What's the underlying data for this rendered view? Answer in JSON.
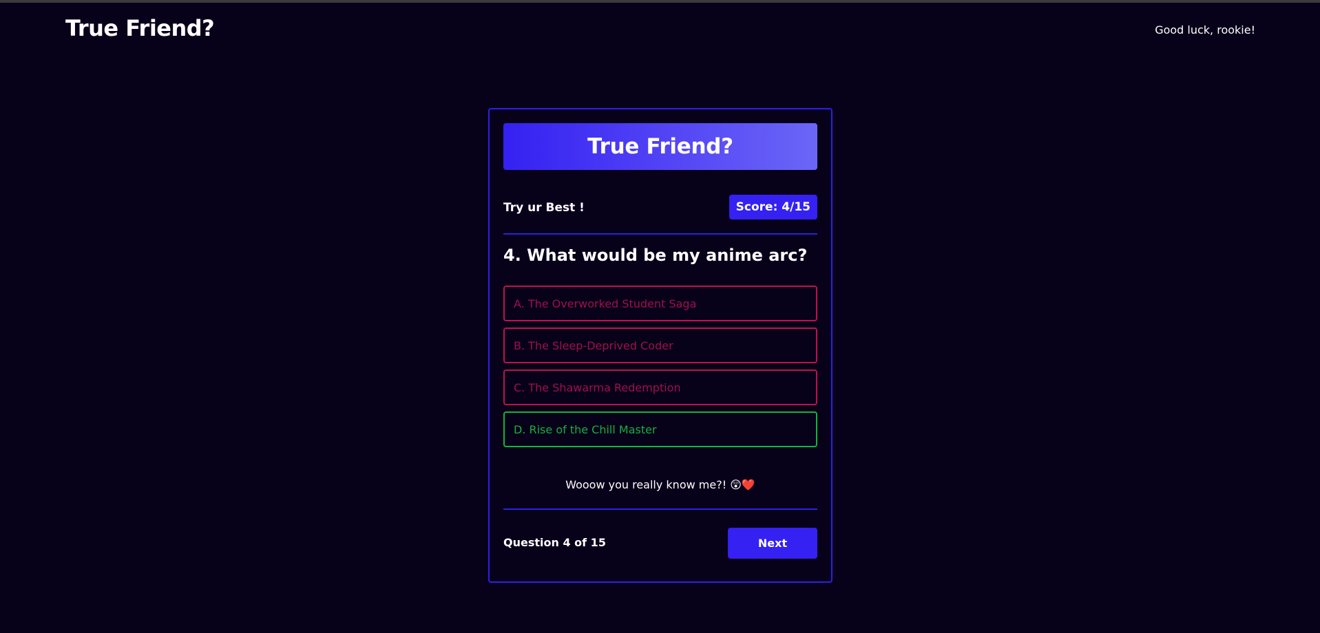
{
  "header": {
    "title": "True Friend?",
    "greeting": "Good luck, rookie!"
  },
  "card": {
    "title": "True Friend?",
    "tagline": "Try ur Best !",
    "score": "Score: 4/15",
    "question": "4. What would be my anime arc?",
    "options": [
      {
        "label": "A. The Overworked Student Saga",
        "state": "incorrect"
      },
      {
        "label": "B. The Sleep-Deprived Coder",
        "state": "incorrect"
      },
      {
        "label": "C. The Shawarma Redemption",
        "state": "incorrect"
      },
      {
        "label": "D. Rise of the Chill Master",
        "state": "correct"
      }
    ],
    "feedback": "Wooow you really know me?! 😲❤️",
    "progress": "Question 4 of 15",
    "next_label": "Next"
  },
  "colors": {
    "background": "#08011a",
    "accent": "#3421f2",
    "incorrect": "#c0124e",
    "correct": "#10b83a"
  }
}
